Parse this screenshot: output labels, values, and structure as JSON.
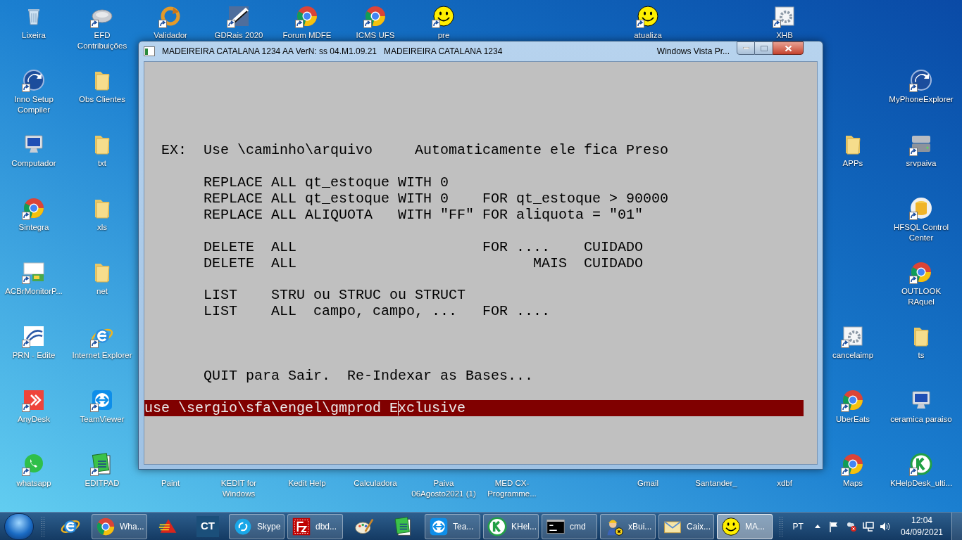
{
  "desktop_icons": [
    {
      "label": "Lixeira",
      "kind": "recycle",
      "shortcut": false
    },
    {
      "label": "EFD Contribuições",
      "kind": "disc",
      "shortcut": true
    },
    {
      "label": "Validador",
      "kind": "ring",
      "shortcut": true
    },
    {
      "label": "GDRais 2020",
      "kind": "bluesquare",
      "shortcut": true
    },
    {
      "label": "Forum MDFE",
      "kind": "chrome",
      "shortcut": true
    },
    {
      "label": "ICMS UFS",
      "kind": "chrome",
      "shortcut": true
    },
    {
      "label": "pre",
      "kind": "smiley",
      "shortcut": true
    },
    {
      "label": "atualiza",
      "kind": "smiley",
      "shortcut": true
    },
    {
      "label": "XHB",
      "kind": "gear",
      "shortcut": true
    },
    {
      "label": "Inno Setup Compiler",
      "kind": "bluecircle",
      "shortcut": true
    },
    {
      "label": "Obs Clientes",
      "kind": "folder",
      "shortcut": false
    },
    {
      "label": "MyPhoneExplorer",
      "kind": "bluecircle",
      "shortcut": true
    },
    {
      "label": "Computador",
      "kind": "computer",
      "shortcut": false
    },
    {
      "label": "txt",
      "kind": "folder",
      "shortcut": false
    },
    {
      "label": "APPs",
      "kind": "folder",
      "shortcut": false
    },
    {
      "label": "srvpaiva",
      "kind": "drive",
      "shortcut": true
    },
    {
      "label": "Sintegra",
      "kind": "chrome",
      "shortcut": true
    },
    {
      "label": "xls",
      "kind": "folder",
      "shortcut": false
    },
    {
      "label": "HFSQL Control Center",
      "kind": "database",
      "shortcut": true
    },
    {
      "label": "ACBrMonitorP...",
      "kind": "greenbox",
      "shortcut": true
    },
    {
      "label": "net",
      "kind": "folder",
      "shortcut": false
    },
    {
      "label": "OUTLOOK RAquel",
      "kind": "chrome",
      "shortcut": true
    },
    {
      "label": "PRN - Edite",
      "kind": "arcs",
      "shortcut": true
    },
    {
      "label": "Internet Explorer",
      "kind": "ie",
      "shortcut": true
    },
    {
      "label": "cancelaimp",
      "kind": "gear",
      "shortcut": true
    },
    {
      "label": "ts",
      "kind": "folder",
      "shortcut": false
    },
    {
      "label": "AnyDesk",
      "kind": "anydesk",
      "shortcut": true
    },
    {
      "label": "TeamViewer",
      "kind": "teamviewer",
      "shortcut": true
    },
    {
      "label": "UberEats",
      "kind": "chrome",
      "shortcut": true
    },
    {
      "label": "ceramica paraiso",
      "kind": "computer",
      "shortcut": false
    },
    {
      "label": "whatsapp",
      "kind": "whatsapp",
      "shortcut": true
    },
    {
      "label": "EDITPAD",
      "kind": "notepad",
      "shortcut": true
    },
    {
      "label": "Paint",
      "kind": "covered",
      "shortcut": false
    },
    {
      "label": "KEDIT for Windows",
      "kind": "covered",
      "shortcut": false
    },
    {
      "label": "Kedit Help",
      "kind": "covered",
      "shortcut": false
    },
    {
      "label": "Calculadora",
      "kind": "covered",
      "shortcut": false
    },
    {
      "label": "Paiva 06Agosto2021 (1)",
      "kind": "covered",
      "shortcut": false
    },
    {
      "label": "MED CX-Programme...",
      "kind": "covered",
      "shortcut": false
    },
    {
      "label": "Gmail",
      "kind": "covered",
      "shortcut": false
    },
    {
      "label": "Santander_",
      "kind": "covered",
      "shortcut": false
    },
    {
      "label": "xdbf",
      "kind": "covered",
      "shortcut": false
    },
    {
      "label": "Maps",
      "kind": "chrome",
      "shortcut": true
    },
    {
      "label": "KHelpDesk_ulti...",
      "kind": "khelp",
      "shortcut": true
    }
  ],
  "window": {
    "title": "MADEIREIRA CATALANA 1234 AA VerN: ss 04.M1.09.21   MADEIREIRA CATALANA 1234",
    "title_right": "Windows Vista Pr...",
    "screen_lines": [
      {
        "text": "  EX:  Use \\caminho\\arquivo     Automaticamente ele fica Preso"
      },
      {
        "text": "       REPLACE ALL qt_estoque WITH 0"
      },
      {
        "text": "       REPLACE ALL qt_estoque WITH 0    FOR qt_estoque > 90000"
      },
      {
        "text": "       REPLACE ALL ALIQUOTA   WITH \"FF\" FOR aliquota = \"01\""
      },
      {
        "text": "       DELETE  ALL                      FOR ....    CUIDADO"
      },
      {
        "text": "       DELETE  ALL                            MAIS  CUIDADO"
      },
      {
        "text": "       LIST    STRU ou STRUC ou STRUCT"
      },
      {
        "text": "       LIST    ALL  campo, campo, ...   FOR ...."
      },
      {
        "text": "       QUIT para Sair.  Re-Indexar as Bases..."
      }
    ],
    "command_line": {
      "value": "use \\sergio\\sfa\\engel\\gmprod Exclusive",
      "caret": {
        "level": 0.7895
      }
    }
  },
  "taskbar": {
    "items": [
      {
        "kind": "ie",
        "selected": false
      },
      {
        "kind": "chrome",
        "label": "Wha...",
        "selected": false
      },
      {
        "kind": "triangle",
        "selected": false
      },
      {
        "kind": "ct",
        "icon_text": "CT",
        "selected": false
      },
      {
        "kind": "skype",
        "label": "Skype",
        "selected": false
      },
      {
        "kind": "filezilla",
        "label": "dbd...",
        "selected": false
      },
      {
        "kind": "palette",
        "selected": false
      },
      {
        "kind": "notepad",
        "selected": false
      },
      {
        "kind": "teamviewer",
        "label": "Tea...",
        "selected": false
      },
      {
        "kind": "khelp",
        "label": "KHel...",
        "selected": false
      },
      {
        "kind": "cmd",
        "label": "cmd",
        "selected": false
      },
      {
        "kind": "worker",
        "label": "xBui...",
        "selected": false
      },
      {
        "kind": "mail",
        "label": "Caix...",
        "selected": false
      },
      {
        "kind": "smiley",
        "label": "MA...",
        "selected": true
      }
    ],
    "language": "PT",
    "time": "12:04",
    "date": "04/09/2021"
  }
}
